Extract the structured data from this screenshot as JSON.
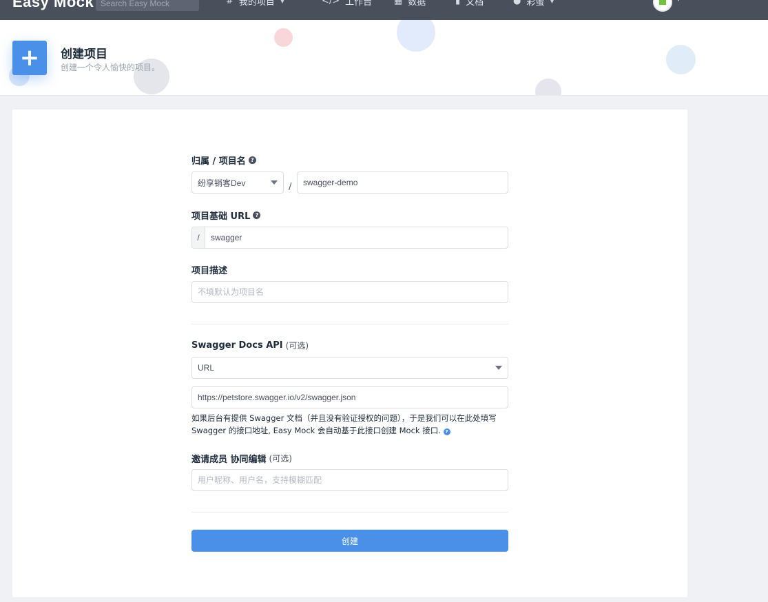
{
  "nav": {
    "brand": "Easy Mock",
    "search_placeholder": "Search Easy Mock",
    "items": [
      {
        "label": "我的项目",
        "icon": "hash-icon",
        "has_caret": true
      },
      {
        "label": "工作台",
        "icon": "code-icon",
        "has_caret": false
      },
      {
        "label": "数据",
        "icon": "chart-icon",
        "has_caret": false
      },
      {
        "label": "文档",
        "icon": "book-icon",
        "has_caret": false
      },
      {
        "label": "彩蛋",
        "icon": "dot-icon",
        "has_caret": true
      }
    ]
  },
  "header": {
    "title": "创建项目",
    "subtitle": "创建一个令人愉快的项目。"
  },
  "form": {
    "owner_label": "归属 / 项目名",
    "owner_value": "纷享销客Dev",
    "separator": "/",
    "project_name": "swagger-demo",
    "url_label": "项目基础 URL",
    "url_prefix": "/",
    "url_value": "swagger",
    "desc_label": "项目描述",
    "desc_placeholder": "不填默认为项目名",
    "swagger_label": "Swagger Docs API",
    "swagger_optional": "(可选)",
    "swagger_type": "URL",
    "swagger_url": "https://petstore.swagger.io/v2/swagger.json",
    "swagger_hint": "如果后台有提供 Swagger 文档（并且没有验证授权的问题），于是我们可以在此处填写 Swagger 的接口地址, Easy Mock 会自动基于此接口创建 Mock 接口.",
    "members_label": "邀请成员 协同编辑",
    "members_optional": "(可选)",
    "members_placeholder": "用户昵称、用户名，支持模糊匹配",
    "submit_label": "创建"
  },
  "colors": {
    "nav_bg": "#4a4f5c",
    "primary": "#4a90e8",
    "page_bg": "#f0f1f4"
  }
}
